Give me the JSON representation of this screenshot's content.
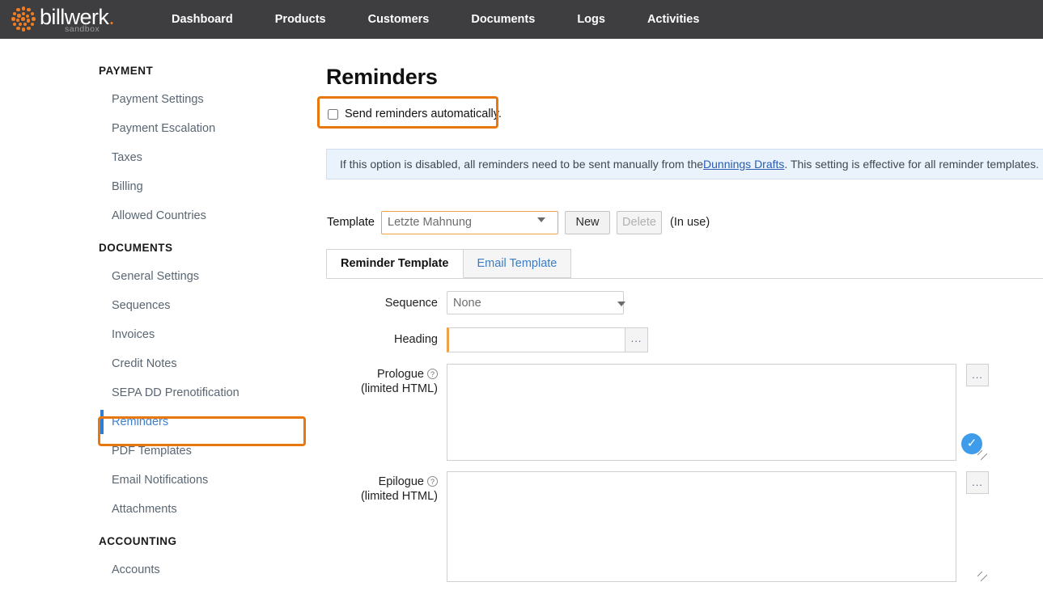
{
  "brand": {
    "wordmark": "billwerk",
    "wordmark_dot": ".",
    "subtitle": "sandbox",
    "logo_color": "#f07d20",
    "navbar_color": "#3e3e40"
  },
  "nav": {
    "items": [
      {
        "label": "Dashboard"
      },
      {
        "label": "Products"
      },
      {
        "label": "Customers"
      },
      {
        "label": "Documents"
      },
      {
        "label": "Logs"
      },
      {
        "label": "Activities"
      }
    ]
  },
  "sidebar": {
    "groups": [
      {
        "title": "PAYMENT",
        "items": [
          {
            "label": "Payment Settings",
            "active": false
          },
          {
            "label": "Payment Escalation",
            "active": false
          },
          {
            "label": "Taxes",
            "active": false
          },
          {
            "label": "Billing",
            "active": false
          },
          {
            "label": "Allowed Countries",
            "active": false
          }
        ]
      },
      {
        "title": "DOCUMENTS",
        "items": [
          {
            "label": "General Settings",
            "active": false
          },
          {
            "label": "Sequences",
            "active": false
          },
          {
            "label": "Invoices",
            "active": false
          },
          {
            "label": "Credit Notes",
            "active": false
          },
          {
            "label": "SEPA DD Prenotification",
            "active": false
          },
          {
            "label": "Reminders",
            "active": true
          },
          {
            "label": "PDF Templates",
            "active": false
          },
          {
            "label": "Email Notifications",
            "active": false
          },
          {
            "label": "Attachments",
            "active": false
          }
        ]
      },
      {
        "title": "ACCOUNTING",
        "items": [
          {
            "label": "Accounts",
            "active": false
          }
        ]
      }
    ],
    "active_highlight_color": "#e8770d",
    "active_marker_color": "#2f7ed8"
  },
  "main": {
    "page_title": "Reminders",
    "auto_send": {
      "label": "Send reminders automatically.",
      "checked": false,
      "annotation_color": "#e8770d"
    },
    "info_banner": {
      "text_before": "If this option is disabled, all reminders need to be sent manually from the ",
      "link_text": "Dunnings Drafts",
      "text_after": ". This setting is effective for all reminder templates.",
      "background": "#eaf2fb",
      "border": "#cfdff0"
    },
    "template_row": {
      "label": "Template",
      "selected": "Letzte Mahnung",
      "options": [
        "Letzte Mahnung"
      ],
      "new_label": "New",
      "delete_label": "Delete",
      "delete_disabled": true,
      "status": "(In use)",
      "focus_border": "#f0a04b"
    },
    "tabs": [
      {
        "label": "Reminder Template",
        "active": true
      },
      {
        "label": "Email Template",
        "active": false
      }
    ],
    "form": {
      "sequence": {
        "label": "Sequence",
        "selected": "None",
        "options": [
          "None"
        ]
      },
      "heading": {
        "label": "Heading",
        "value": "",
        "dots_label": "...",
        "marker_color": "#f0a04b"
      },
      "prologue": {
        "label": "Prologue",
        "sub_label": "(limited HTML)",
        "help_icon": "?",
        "value": "",
        "dots_label": "...",
        "badge_icon": "✓",
        "badge_color": "#3f9ceb"
      },
      "epilogue": {
        "label": "Epilogue",
        "sub_label": "(limited HTML)",
        "help_icon": "?",
        "value": "",
        "dots_label": "..."
      }
    }
  }
}
